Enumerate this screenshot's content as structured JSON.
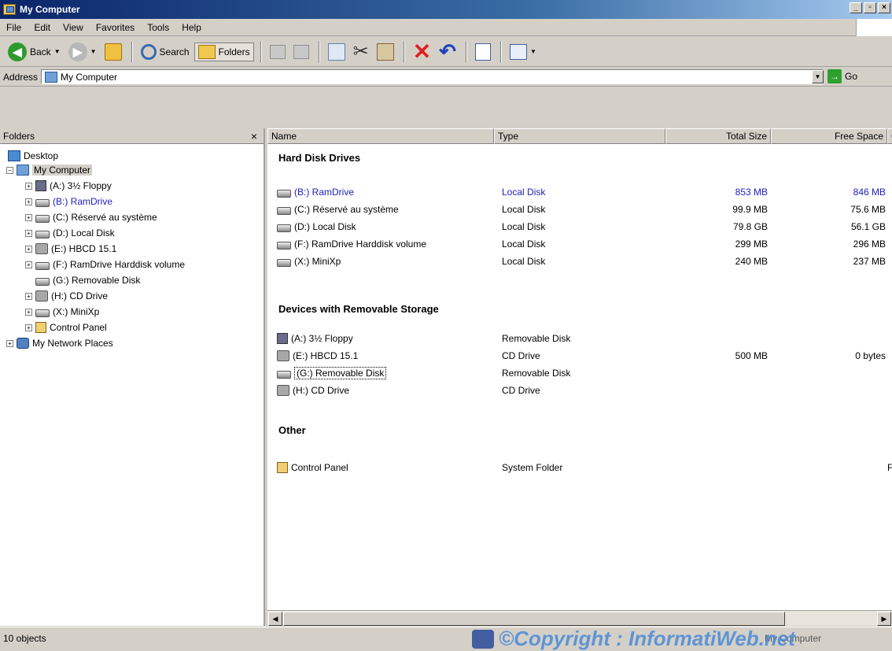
{
  "window": {
    "title": "My Computer",
    "min": "_",
    "max": "▫",
    "close": "×"
  },
  "menu": [
    "File",
    "Edit",
    "View",
    "Favorites",
    "Tools",
    "Help"
  ],
  "toolbar": {
    "back": "Back",
    "search": "Search",
    "folders": "Folders"
  },
  "address": {
    "label": "Address",
    "value": "My Computer",
    "go": "Go"
  },
  "folders_pane": {
    "title": "Folders",
    "close": "×",
    "tree": [
      {
        "label": "Desktop",
        "icon": "desktop-icon",
        "level": 0
      },
      {
        "label": "My Computer",
        "icon": "my-computer-icon",
        "level": 1,
        "expander": "−",
        "selected": true
      },
      {
        "label": "(A:) 3½ Floppy",
        "icon": "floppy-drive-icon",
        "level": 2,
        "expander": "+"
      },
      {
        "label": "(B:) RamDrive",
        "icon": "hard-drive-icon",
        "level": 2,
        "expander": "+",
        "blue": true
      },
      {
        "label": "(C:) Réservé au système",
        "icon": "hard-drive-icon",
        "level": 2,
        "expander": "+"
      },
      {
        "label": "(D:) Local Disk",
        "icon": "hard-drive-icon",
        "level": 2,
        "expander": "+"
      },
      {
        "label": "(E:) HBCD 15.1",
        "icon": "cd-drive-icon",
        "level": 2,
        "expander": "+"
      },
      {
        "label": "(F:) RamDrive Harddisk volume",
        "icon": "hard-drive-icon",
        "level": 2,
        "expander": "+"
      },
      {
        "label": "(G:) Removable Disk",
        "icon": "removable-disk-icon",
        "level": 2
      },
      {
        "label": "(H:) CD Drive",
        "icon": "cd-drive-icon",
        "level": 2,
        "expander": "+"
      },
      {
        "label": "(X:) MiniXp",
        "icon": "hard-drive-icon",
        "level": 2,
        "expander": "+"
      },
      {
        "label": "Control Panel",
        "icon": "control-panel-icon",
        "level": 2,
        "expander": "+"
      },
      {
        "label": "My Network Places",
        "icon": "network-places-icon",
        "level": 1,
        "expander": "+"
      }
    ]
  },
  "list": {
    "columns": {
      "name": "Name",
      "type": "Type",
      "total": "Total Size",
      "free": "Free Space",
      "comments": "C"
    },
    "groups": [
      {
        "title": "Hard Disk Drives",
        "rows": [
          {
            "name": "(B:) RamDrive",
            "type": "Local Disk",
            "total": "853 MB",
            "free": "846 MB",
            "icon": "hard-drive-icon",
            "blue": true
          },
          {
            "name": "(C:) Réservé au système",
            "type": "Local Disk",
            "total": "99.9 MB",
            "free": "75.6 MB",
            "icon": "hard-drive-icon"
          },
          {
            "name": "(D:) Local Disk",
            "type": "Local Disk",
            "total": "79.8 GB",
            "free": "56.1 GB",
            "icon": "hard-drive-icon"
          },
          {
            "name": "(F:) RamDrive Harddisk volume",
            "type": "Local Disk",
            "total": "299 MB",
            "free": "296 MB",
            "icon": "hard-drive-icon"
          },
          {
            "name": "(X:) MiniXp",
            "type": "Local Disk",
            "total": "240 MB",
            "free": "237 MB",
            "icon": "hard-drive-icon"
          }
        ]
      },
      {
        "title": "Devices with Removable Storage",
        "rows": [
          {
            "name": "(A:) 3½ Floppy",
            "type": "Removable Disk",
            "total": "",
            "free": "",
            "icon": "floppy-drive-icon"
          },
          {
            "name": "(E:) HBCD 15.1",
            "type": "CD Drive",
            "total": "500 MB",
            "free": "0 bytes",
            "icon": "cd-drive-icon"
          },
          {
            "name": "(G:) Removable Disk",
            "type": "Removable Disk",
            "total": "",
            "free": "",
            "icon": "removable-disk-icon",
            "focused": true
          },
          {
            "name": "(H:) CD Drive",
            "type": "CD Drive",
            "total": "",
            "free": "",
            "icon": "cd-drive-icon"
          }
        ]
      },
      {
        "title": "Other",
        "rows": [
          {
            "name": "Control Panel",
            "type": "System Folder",
            "total": "",
            "free": "",
            "comment": "F",
            "icon": "control-panel-icon"
          }
        ]
      }
    ]
  },
  "status": {
    "objects": "10 objects",
    "right": "My Computer"
  },
  "watermark": "©Copyright : InformatiWeb.net"
}
